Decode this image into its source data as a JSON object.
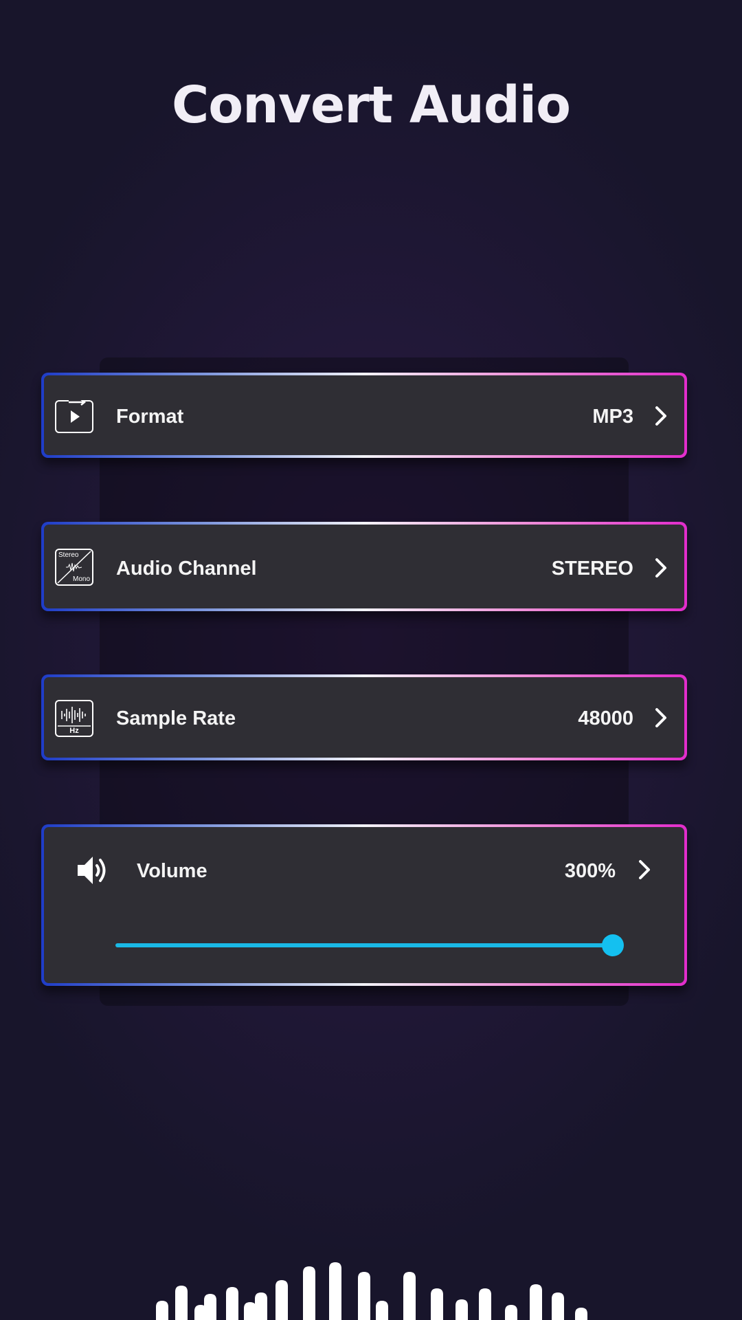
{
  "header": {
    "title": "Convert Audio"
  },
  "settings": {
    "format": {
      "label": "Format",
      "value": "MP3",
      "icon": "play-file-icon"
    },
    "audio_channel": {
      "label": "Audio Channel",
      "value": "STEREO",
      "icon": "stereo-mono-icon",
      "icon_text_top": "Stereo",
      "icon_text_bottom": "Mono"
    },
    "sample_rate": {
      "label": "Sample Rate",
      "value": "48000",
      "icon": "waveform-hz-icon",
      "icon_text": "Hz"
    },
    "volume": {
      "label": "Volume",
      "value": "300%",
      "icon": "speaker-icon",
      "slider_level": 1.0
    }
  },
  "colors": {
    "accent": "#14c0f0",
    "gradient_start": "#1e3cc8",
    "gradient_end": "#e22ccc",
    "card_bg": "#2f2e34",
    "page_bg": "#18152b"
  }
}
